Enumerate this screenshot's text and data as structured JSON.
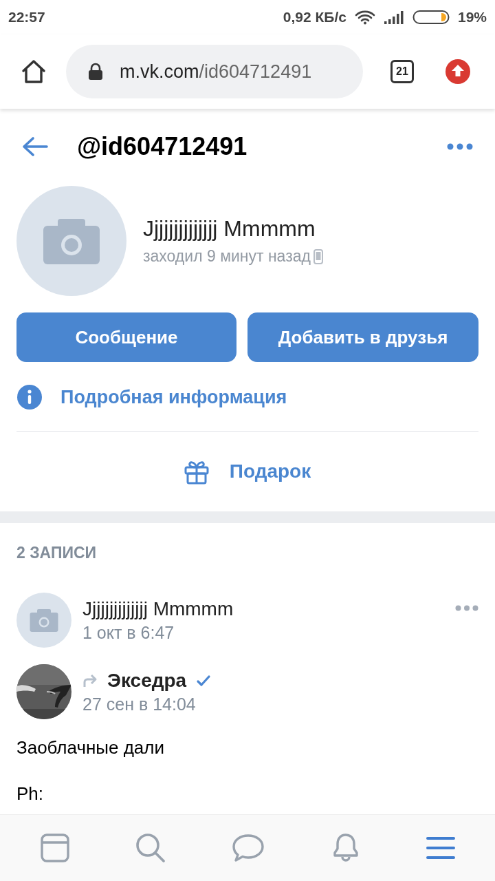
{
  "status_bar": {
    "time": "22:57",
    "network_speed": "0,92 КБ/с",
    "battery": "19%"
  },
  "browser": {
    "url_host": "m.vk.com",
    "url_path": "/id604712491",
    "tab_count": "21"
  },
  "header": {
    "handle": "@id604712491"
  },
  "profile": {
    "name": "Jjjjjjjjjjjjjj Mmmmm",
    "last_seen": "заходил 9 минут назад"
  },
  "buttons": [
    "Сообщение",
    "Добавить в друзья"
  ],
  "info_link": "Подробная информация",
  "gift": "Подарок",
  "posts_count": "2 ЗАПИСИ",
  "post": {
    "author": "Jjjjjjjjjjjjjj Mmmmm",
    "date": "1 окт в 6:47"
  },
  "repost": {
    "author": "Экседра",
    "date": "27 сен в 14:04",
    "verified": true
  },
  "post_text": [
    "Заоблачные дали",
    "Ph:"
  ],
  "tab_bar": [
    {
      "kind": "feed",
      "selected": false
    },
    {
      "kind": "search",
      "selected": false
    },
    {
      "kind": "messages",
      "selected": false
    },
    {
      "kind": "notifications",
      "selected": false
    },
    {
      "kind": "menu",
      "selected": true
    }
  ]
}
